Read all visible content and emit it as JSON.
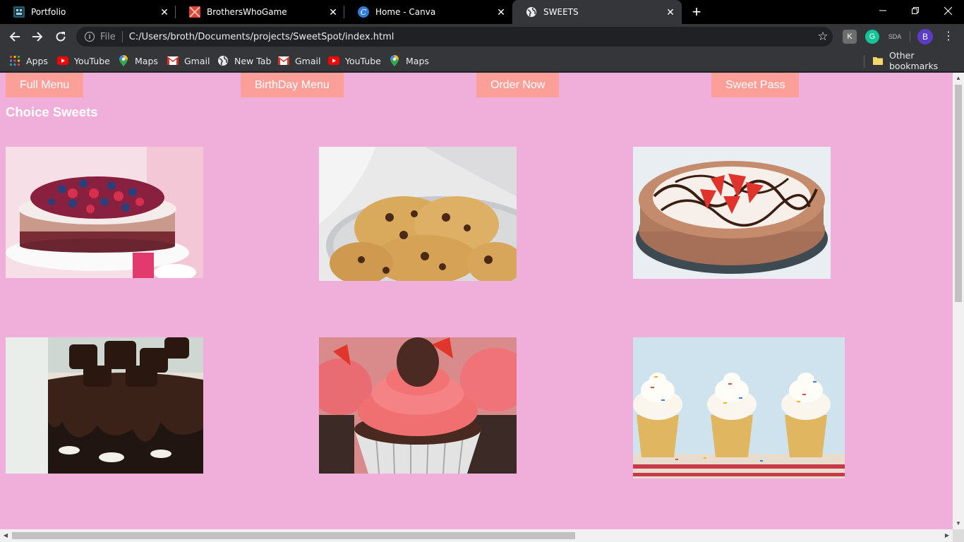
{
  "browser": {
    "tabs": [
      {
        "title": "Portfolio",
        "icon": "portfolio-favicon",
        "active": false
      },
      {
        "title": "BrothersWhoGame",
        "icon": "brotherswhogame-favicon",
        "active": false
      },
      {
        "title": "Home - Canva",
        "icon": "canva-favicon",
        "active": false
      },
      {
        "title": "SWEETS",
        "icon": "globe-icon",
        "active": true
      }
    ],
    "new_tab_glyph": "+",
    "address": {
      "scheme_label": "File",
      "url": "C:/Users/broth/Documents/projects/SweetSpot/index.html"
    },
    "profile_initial": "B",
    "bookmarks": [
      {
        "label": "Apps",
        "icon": "apps-grid-icon"
      },
      {
        "label": "YouTube",
        "icon": "youtube-icon"
      },
      {
        "label": "Maps",
        "icon": "maps-icon"
      },
      {
        "label": "Gmail",
        "icon": "gmail-icon"
      },
      {
        "label": "New Tab",
        "icon": "globe-icon"
      },
      {
        "label": "Gmail",
        "icon": "gmail-icon"
      },
      {
        "label": "YouTube",
        "icon": "youtube-icon"
      },
      {
        "label": "Maps",
        "icon": "maps-icon"
      }
    ],
    "other_bookmarks": "Other bookmarks"
  },
  "page": {
    "nav": [
      {
        "label": "Full Menu"
      },
      {
        "label": "BirthDay Menu"
      },
      {
        "label": "Order Now"
      },
      {
        "label": "Sweet Pass"
      }
    ],
    "heading": "Choice Sweets",
    "gallery": [
      {
        "name": "berry-ice-cream-cake-photo"
      },
      {
        "name": "chocolate-chip-cookies-photo"
      },
      {
        "name": "strawberry-chocolate-cheesecake-photo"
      },
      {
        "name": "brownie-chocolate-cake-photo"
      },
      {
        "name": "chocolate-strawberry-cupcakes-photo"
      },
      {
        "name": "vanilla-sprinkle-cupcakes-photo"
      }
    ]
  },
  "colors": {
    "page_background": "#f0aedb",
    "nav_button": "#fb9f98",
    "heading_text": "#ffffff"
  }
}
